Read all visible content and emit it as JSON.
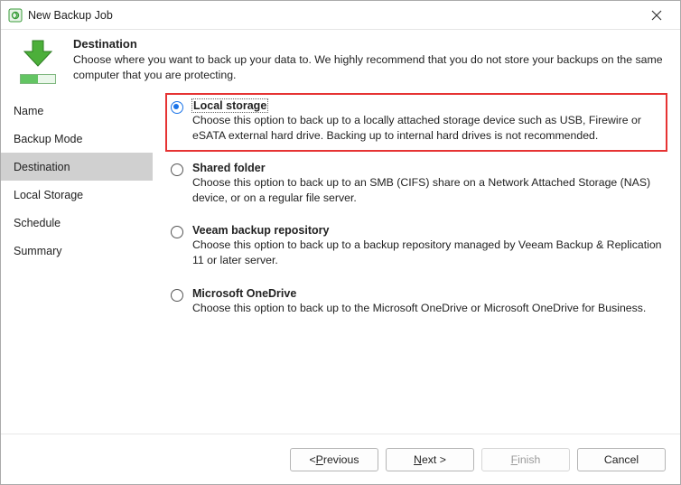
{
  "window": {
    "title": "New Backup Job",
    "close_label": "Close"
  },
  "header": {
    "title": "Destination",
    "description": "Choose where you want to back up your data to. We highly recommend that you do not store your backups on the same computer that you are protecting."
  },
  "sidebar": {
    "items": [
      {
        "label": "Name",
        "active": false
      },
      {
        "label": "Backup Mode",
        "active": false
      },
      {
        "label": "Destination",
        "active": true
      },
      {
        "label": "Local Storage",
        "active": false
      },
      {
        "label": "Schedule",
        "active": false
      },
      {
        "label": "Summary",
        "active": false
      }
    ]
  },
  "options": [
    {
      "id": "local-storage",
      "title": "Local storage",
      "description": "Choose this option to back up to a locally attached storage device such as USB, Firewire or eSATA external hard drive. Backing up to internal hard drives is not recommended.",
      "checked": true,
      "highlighted": true
    },
    {
      "id": "shared-folder",
      "title": "Shared folder",
      "description": "Choose this option to back up to an SMB (CIFS) share on a Network Attached Storage (NAS) device, or on a regular file server.",
      "checked": false,
      "highlighted": false
    },
    {
      "id": "veeam-repo",
      "title": "Veeam backup repository",
      "description": "Choose this option to back up to a backup repository managed by Veeam Backup & Replication 11 or later server.",
      "checked": false,
      "highlighted": false
    },
    {
      "id": "onedrive",
      "title": "Microsoft OneDrive",
      "description": "Choose this option to back up to the Microsoft OneDrive or Microsoft OneDrive for Business.",
      "checked": false,
      "highlighted": false
    }
  ],
  "footer": {
    "previous": "< Previous",
    "next": "Next >",
    "finish": "Finish",
    "cancel": "Cancel",
    "previous_u": "P",
    "next_u": "N",
    "finish_u": "F"
  }
}
